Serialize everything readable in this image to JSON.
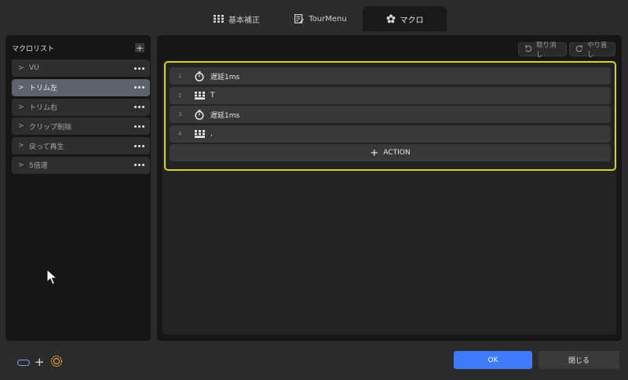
{
  "tabs": [
    {
      "label": "基本補正",
      "icon": "grid-icon"
    },
    {
      "label": "TourMenu",
      "icon": "edit-list-icon"
    },
    {
      "label": "マクロ",
      "icon": "flower-icon",
      "active": true
    }
  ],
  "sidebar": {
    "title": "マクロリスト",
    "items": [
      {
        "label": "VU"
      },
      {
        "label": "トリム左",
        "selected": true
      },
      {
        "label": "トリム右"
      },
      {
        "label": "クリップ削除"
      },
      {
        "label": "戻って再生"
      },
      {
        "label": "5倍速"
      }
    ]
  },
  "toolbar": {
    "undo_label": "取り消し",
    "redo_label": "やり直し"
  },
  "actions": [
    {
      "num": "1",
      "icon": "timer-icon",
      "text": "遅延1ms"
    },
    {
      "num": "2",
      "icon": "keyboard-icon",
      "text": "T"
    },
    {
      "num": "3",
      "icon": "timer-icon",
      "text": "遅延1ms"
    },
    {
      "num": "4",
      "icon": "keyboard-icon",
      "text": ","
    }
  ],
  "add_action_label": "ACTION",
  "footer": {
    "ok_label": "OK",
    "close_label": "閉じる"
  },
  "colors": {
    "accent": "#3f7bff",
    "highlight_border": "#d4d41e",
    "selected_item": "#5b6469"
  }
}
